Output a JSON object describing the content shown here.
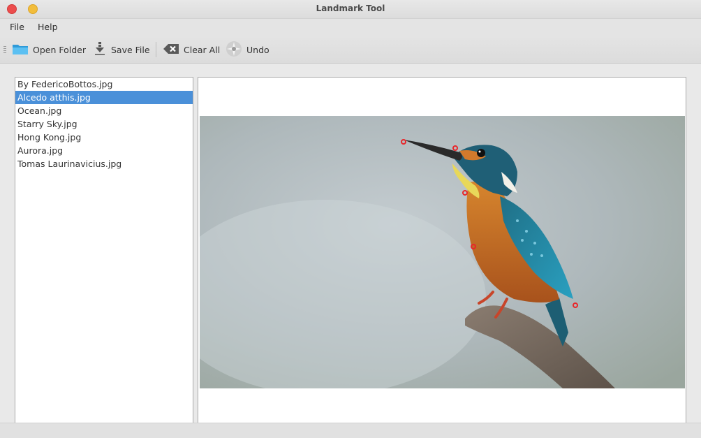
{
  "window": {
    "title": "Landmark Tool"
  },
  "menu": {
    "items": [
      {
        "label": "File"
      },
      {
        "label": "Help"
      }
    ]
  },
  "toolbar": {
    "open_folder": {
      "label": "Open Folder",
      "icon": "folder-icon"
    },
    "save_file": {
      "label": "Save File",
      "icon": "download-icon"
    },
    "clear_all": {
      "label": "Clear All",
      "icon": "clear-icon"
    },
    "undo": {
      "label": "Undo",
      "icon": "undo-icon"
    }
  },
  "files": {
    "selected_index": 1,
    "items": [
      "By FedericoBottos.jpg",
      "Alcedo atthis.jpg",
      "Ocean.jpg",
      "Starry Sky.jpg",
      "Hong Kong.jpg",
      "Aurora.jpg",
      "Tomas Laurinavicius.jpg"
    ]
  },
  "viewer": {
    "landmark_count": 6,
    "colors": {
      "landmark": "#e8262a",
      "selection": "#4a90d9"
    }
  }
}
